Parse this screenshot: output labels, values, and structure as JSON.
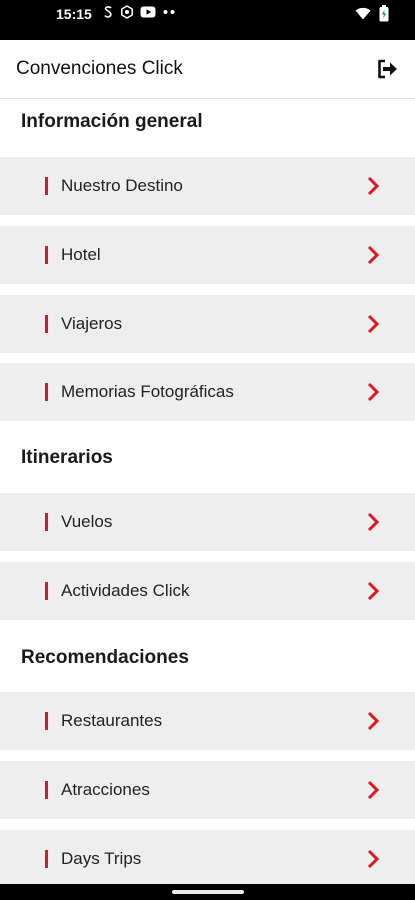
{
  "status_bar": {
    "time": "15:15",
    "icons": [
      "s-notification-icon",
      "settings-notification-icon",
      "youtube-icon",
      "more-dots-icon",
      "wifi-icon",
      "battery-icon"
    ]
  },
  "app_bar": {
    "title": "Convenciones Click",
    "logout_icon": "logout-icon"
  },
  "sections": [
    {
      "title": "Información general",
      "items": [
        "Nuestro Destino",
        "Hotel",
        "Viajeros",
        "Memorias Fotográficas"
      ]
    },
    {
      "title": "Itinerarios",
      "items": [
        "Vuelos",
        "Actividades Click"
      ]
    },
    {
      "title": "Recomendaciones",
      "items": [
        "Restaurantes",
        "Atracciones",
        "Days Trips"
      ]
    }
  ],
  "colors": {
    "accent": "#e4151f",
    "item_background": "#eeeeee",
    "status_bar": "#000000"
  }
}
